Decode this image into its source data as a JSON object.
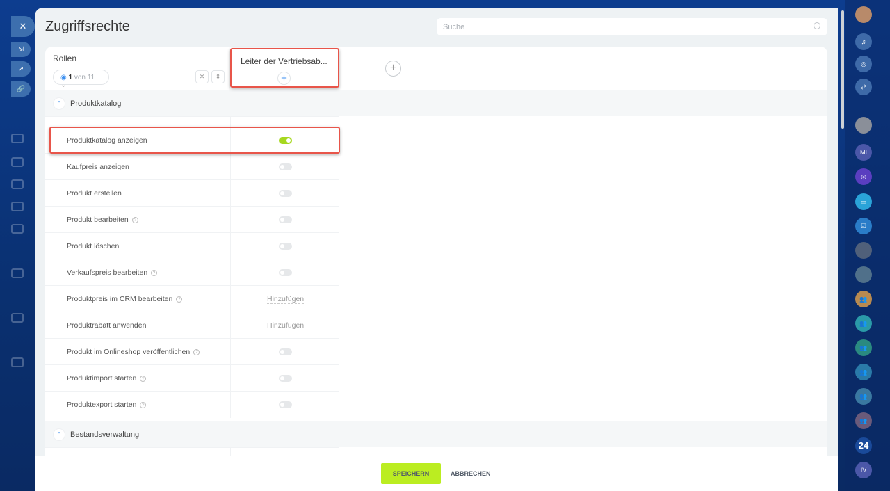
{
  "page": {
    "title": "Zugriffsrechte",
    "search_placeholder": "Suche"
  },
  "roles": {
    "label": "Rollen",
    "counter_current": "1",
    "counter_total": "von 11",
    "column": "Leiter der Vertriebsab..."
  },
  "sections": [
    {
      "title": "Produktkatalog",
      "rows": [
        {
          "label": "Produktkatalog anzeigen",
          "help": false,
          "type": "toggle",
          "on": true
        },
        {
          "label": "Kaufpreis anzeigen",
          "help": false,
          "type": "toggle",
          "on": false
        },
        {
          "label": "Produkt erstellen",
          "help": false,
          "type": "toggle",
          "on": false
        },
        {
          "label": "Produkt bearbeiten",
          "help": true,
          "type": "toggle",
          "on": false
        },
        {
          "label": "Produkt löschen",
          "help": false,
          "type": "toggle",
          "on": false
        },
        {
          "label": "Verkaufspreis bearbeiten",
          "help": true,
          "type": "toggle",
          "on": false
        },
        {
          "label": "Produktpreis im CRM bearbeiten",
          "help": true,
          "type": "add",
          "value": "Hinzufügen"
        },
        {
          "label": "Produktrabatt anwenden",
          "help": false,
          "type": "add",
          "value": "Hinzufügen"
        },
        {
          "label": "Produkt im Onlineshop veröffentlichen",
          "help": true,
          "type": "toggle",
          "on": false
        },
        {
          "label": "Produktimport starten",
          "help": true,
          "type": "toggle",
          "on": false
        },
        {
          "label": "Produktexport starten",
          "help": true,
          "type": "toggle",
          "on": false
        }
      ]
    },
    {
      "title": "Bestandsverwaltung",
      "rows": []
    }
  ],
  "footer": {
    "save": "SPEICHERN",
    "cancel": "ABBRECHEN"
  },
  "rightbar": {
    "initials_1": "MI",
    "counter": "24",
    "initials_2": "IV"
  },
  "colors": {
    "accent": "#bbed21",
    "toggle_on": "#a6d81f",
    "highlight": "#e8554a"
  }
}
